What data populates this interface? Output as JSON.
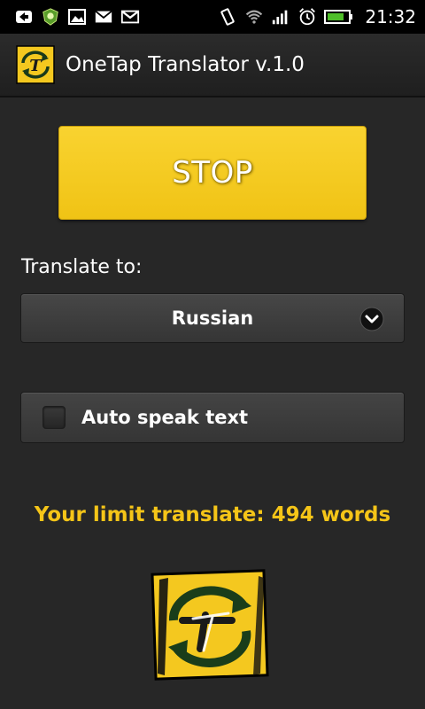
{
  "status_bar": {
    "time": "21:32",
    "icons": [
      "back-arrow-icon",
      "shield-app-icon",
      "gallery-icon",
      "mail-icon",
      "gmail-icon",
      "vibrate-icon",
      "wifi-icon",
      "signal-icon",
      "alarm-icon",
      "battery-icon"
    ]
  },
  "header": {
    "title": "OneTap Translator v.1.0",
    "icon": "app-logo-icon"
  },
  "main": {
    "stop_label": "STOP",
    "translate_to_label": "Translate to:",
    "language_selected": "Russian",
    "auto_speak_label": "Auto speak text",
    "auto_speak_checked": false,
    "limit_text": "Your limit translate: 494 words"
  },
  "colors": {
    "accent": "#f5c518",
    "background": "#272727",
    "button_yellow": "#f4c81f"
  }
}
